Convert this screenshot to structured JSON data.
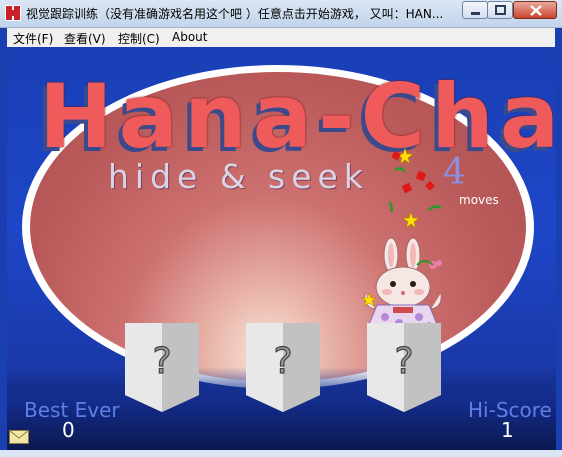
{
  "window": {
    "title": "视觉跟踪训练（没有准确游戏名用这个吧 ）任意点击开始游戏， 又叫：HAN..."
  },
  "menu": {
    "items": [
      {
        "label": "文件(F)"
      },
      {
        "label": "查看(V)"
      },
      {
        "label": "控制(C)"
      },
      {
        "label": "About"
      }
    ]
  },
  "game": {
    "logo_title": "Hana-Cha",
    "logo_subtitle": "hide & seek",
    "moves_count": "4",
    "moves_label": "moves",
    "card_symbol": "?",
    "best_ever_label": "Best Ever",
    "best_ever_value": "0",
    "hi_score_label": "Hi-Score",
    "hi_score_value": "1"
  },
  "colors": {
    "background": "#1a3fb0",
    "logo_red": "#ef5a5a",
    "oval_red": "#b85858",
    "score_label": "#5c7fe8"
  }
}
